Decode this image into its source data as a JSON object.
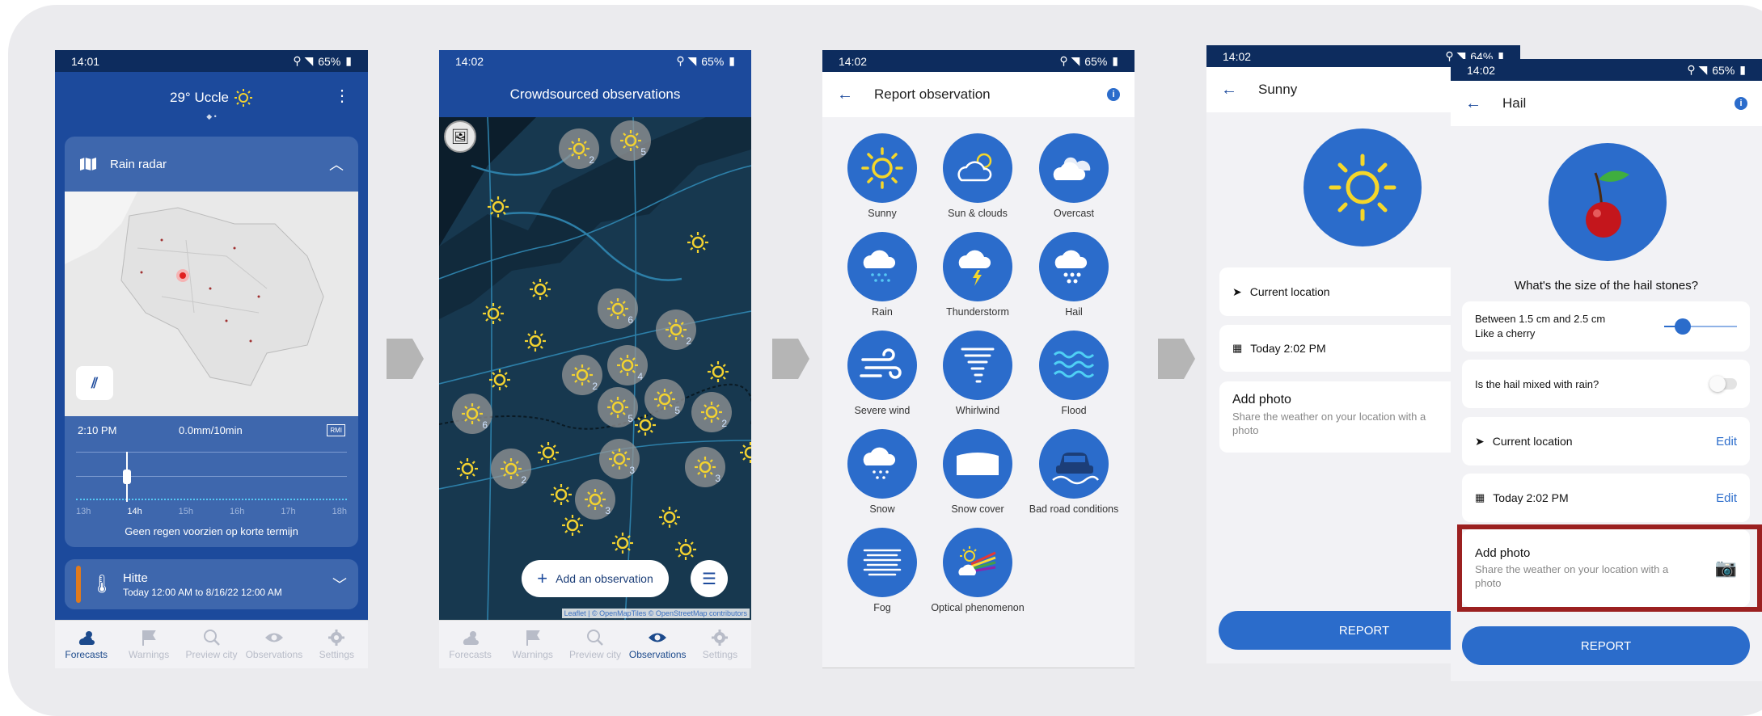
{
  "screen1": {
    "status_time": "14:01",
    "battery": "65%",
    "header_title": "29° Uccle",
    "rain_radar_label": "Rain radar",
    "radar_time": "2:10 PM",
    "radar_amount": "0.0mm/10min",
    "radar_ticks": [
      "13h",
      "14h",
      "15h",
      "16h",
      "17h",
      "18h"
    ],
    "radar_message": "Geen regen voorzien op korte termijn",
    "logo_text": "RMI",
    "warning_title": "Hitte",
    "warning_dates": "Today 12:00 AM to 8/16/22 12:00 AM",
    "warning_color": "#e07a1c"
  },
  "nav": {
    "forecasts": "Forecasts",
    "warnings": "Warnings",
    "preview_city": "Preview city",
    "observations": "Observations",
    "settings": "Settings"
  },
  "screen2": {
    "status_time": "14:02",
    "battery": "65%",
    "title": "Crowdsourced observations",
    "add_button": "Add an observation",
    "attribution": "Leaflet | © OpenMapTiles © OpenStreetMap contributors",
    "clusters": [
      "2",
      "5",
      "6",
      "2",
      "4",
      "2",
      "5",
      "5",
      "2",
      "6",
      "3",
      "3",
      "3",
      "2"
    ]
  },
  "screen3": {
    "status_time": "14:02",
    "battery": "65%",
    "title": "Report observation",
    "items": [
      "Sunny",
      "Sun & clouds",
      "Overcast",
      "Rain",
      "Thunderstorm",
      "Hail",
      "Severe wind",
      "Whirlwind",
      "Flood",
      "Snow",
      "Snow cover",
      "Bad road conditions",
      "Fog",
      "Optical phenomenon"
    ]
  },
  "screen4": {
    "status_time": "14:02",
    "battery": "64%",
    "title": "Sunny",
    "location": "Current location",
    "datetime": "Today 2:02 PM",
    "add_photo": "Add photo",
    "add_photo_sub": "Share the weather on your location with a photo",
    "report": "REPORT"
  },
  "screen5": {
    "status_time": "14:02",
    "battery": "65%",
    "title": "Hail",
    "question": "What's the size of the hail stones?",
    "size_line1": "Between 1.5 cm and 2.5 cm",
    "size_line2": "Like a cherry",
    "size_slider_level": 0.25,
    "mixed_rain": "Is the hail mixed with rain?",
    "location": "Current location",
    "datetime": "Today 2:02 PM",
    "edit": "Edit",
    "add_photo": "Add photo",
    "add_photo_sub": "Share the weather on your location with a photo",
    "report": "REPORT",
    "highlight_color": "#9b2020"
  }
}
